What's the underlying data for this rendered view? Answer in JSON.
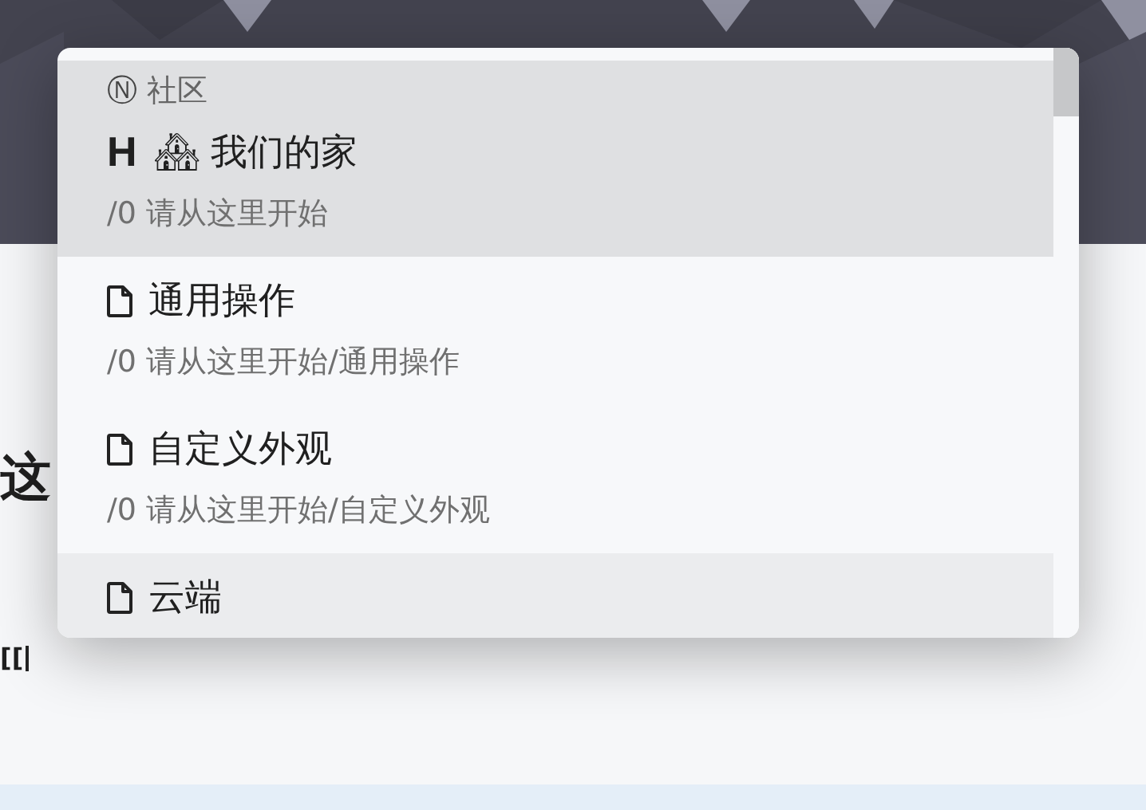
{
  "editor": {
    "heading_fragment": "这",
    "text_fragment": "[["
  },
  "menu": {
    "section": {
      "icon": "Ⓝ",
      "label": "社区"
    },
    "items": [
      {
        "kind": "heading",
        "marker": "H",
        "title": "🏘 我们的家",
        "path": "/0 请从这里开始",
        "selected": true,
        "hovered": false
      },
      {
        "kind": "doc",
        "title": "通用操作",
        "path": "/0 请从这里开始/通用操作",
        "selected": false,
        "hovered": false
      },
      {
        "kind": "doc",
        "title": "自定义外观",
        "path": "/0 请从这里开始/自定义外观",
        "selected": false,
        "hovered": false
      },
      {
        "kind": "doc",
        "title": "云端",
        "selected": false,
        "hovered": true
      }
    ]
  }
}
